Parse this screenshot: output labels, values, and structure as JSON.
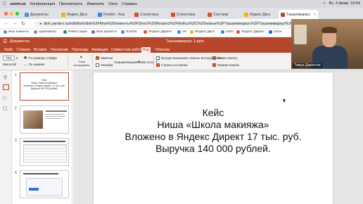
{
  "menubar": {
    "items": [
      "zoom.us",
      "Конференция",
      "Просмотреть",
      "Изменить",
      "Окно",
      "Справка"
    ],
    "clock": "Вс, 4 февр.  19:54"
  },
  "browser": {
    "tabs": [
      {
        "label": "Документы",
        "color": "#4a90d9"
      },
      {
        "label": "Яндекс Диск",
        "color": "#f5b400"
      },
      {
        "label": "Rotobit – Ана",
        "color": "#3b82f6"
      },
      {
        "label": "Статистика",
        "color": "#e04a2f"
      },
      {
        "label": "Статистика",
        "color": "#e04a2f"
      },
      {
        "label": "Счетчики",
        "color": "#e04a2f"
      },
      {
        "label": "Яндекс Диск",
        "color": "#f5b400"
      },
      {
        "label": "Ташаевмаркус",
        "color": "#b7472a"
      }
    ],
    "url": "disk.yandex.ru/edit/disk/disk%2FМои%20клиенты%2FDirect%20Respect%2FКейсы%2C%20новые%2FТашаевмаркус%2FТашаевмаркус%201.pptx?sk=y46e",
    "bookmarks": [
      "Мои клиенты",
      "Цианометр",
      "Инвестиции",
      "Мои проекты",
      "Rotobit",
      "Яндекс Директ",
      "VK",
      "Яндекс Диск",
      "AMO",
      "Яндекс Директ",
      "Ozon",
      "Заметки"
    ]
  },
  "app": {
    "name": "Документы",
    "doc_title": "Ташаевмаркус 1.pptx",
    "tabs": [
      "Файл",
      "Главная",
      "Вставка",
      "Рисование",
      "Переходы",
      "Анимация",
      "Совместная работа",
      "Вид",
      "Плагины"
    ],
    "active_tab": "Вид",
    "accent": "#b7472a"
  },
  "ribbon": {
    "zoom_value": "75%",
    "fit_slide": "По размеру слайда",
    "fit_width": "По ширине",
    "scale_label": "Масштаб",
    "theme_label": "Тема интерфейса",
    "notes_label": "Заметки",
    "ruler_label": "Линейки",
    "guides_label": "Направляющие",
    "grid_label": "Линии сетки",
    "always_toolbar": "Всегда показывать панель инструментов",
    "status_bar": "Строка состояния",
    "left_panel": "Левая панель",
    "right_panel": "Правая панель"
  },
  "slides": {
    "numbers": [
      "1",
      "2",
      "3",
      "4"
    ],
    "thumb1_lines": [
      "Кейс",
      "Ниша «Школа макияжа»",
      "Вложено в Яндекс Директ 17 тыс. руб.",
      "Выручка 140 000 рублей."
    ]
  },
  "slide": {
    "lines": [
      "Кейс",
      "Ниша «Школа макияжа»",
      "Вложено в Яндекс Директ 17 тыс. руб.",
      "Выручка 140 000 рублей."
    ]
  },
  "webcam": {
    "name": "Тимур Давлетов"
  }
}
